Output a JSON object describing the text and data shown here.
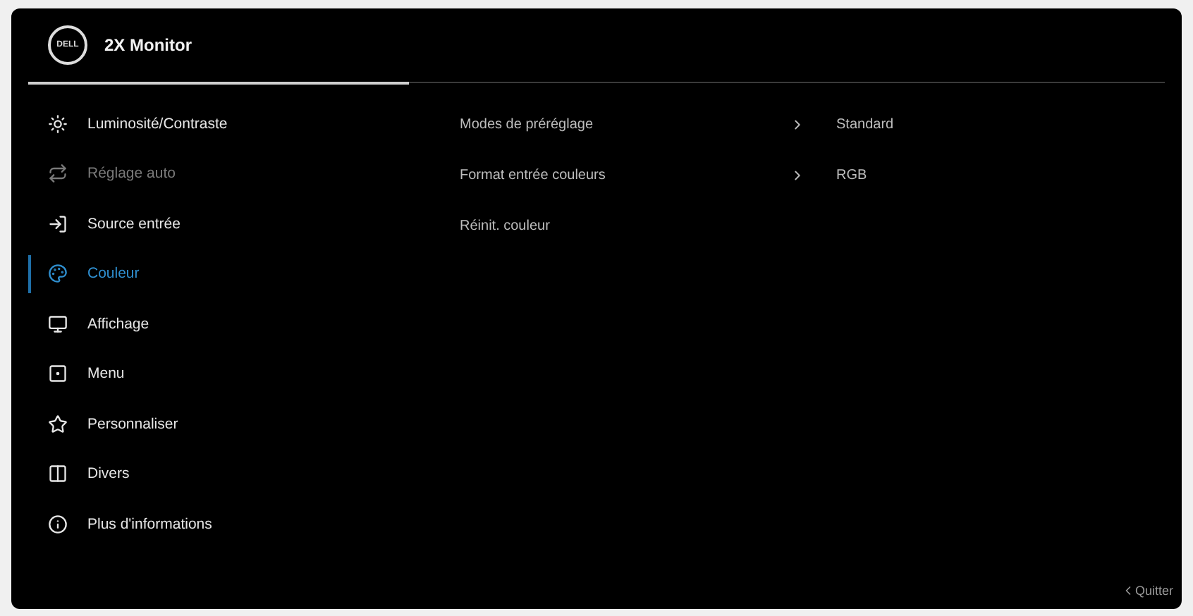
{
  "header": {
    "logo": "DELL",
    "title": "2X Monitor"
  },
  "menu": [
    {
      "label": "Luminosité/Contraste",
      "selected": false,
      "disabled": false
    },
    {
      "label": "Réglage auto",
      "selected": false,
      "disabled": true
    },
    {
      "label": "Source entrée",
      "selected": false,
      "disabled": false
    },
    {
      "label": "Couleur",
      "selected": true,
      "disabled": false
    },
    {
      "label": "Affichage",
      "selected": false,
      "disabled": false
    },
    {
      "label": "Menu",
      "selected": false,
      "disabled": false
    },
    {
      "label": "Personnaliser",
      "selected": false,
      "disabled": false
    },
    {
      "label": "Divers",
      "selected": false,
      "disabled": false
    },
    {
      "label": "Plus d'informations",
      "selected": false,
      "disabled": false
    }
  ],
  "settings": [
    {
      "label": "Modes de préréglage",
      "value": "Standard"
    },
    {
      "label": "Format entrée couleurs",
      "value": "RGB"
    },
    {
      "label": "Réinit. couleur"
    }
  ],
  "exit": "Quitter"
}
